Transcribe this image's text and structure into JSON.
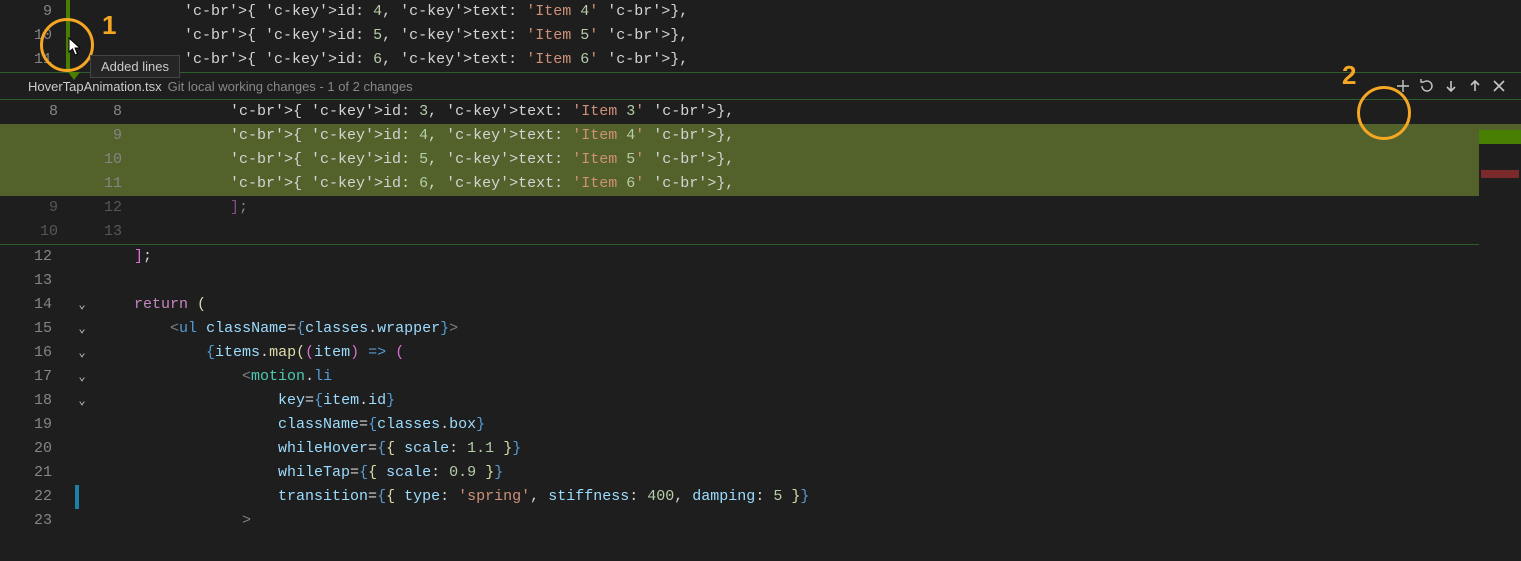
{
  "tooltip": "Added lines",
  "callouts": {
    "one": "1",
    "two": "2"
  },
  "top_editor": {
    "lines": [
      {
        "n": "9",
        "code": "{ id: 4, text: 'Item 4' },"
      },
      {
        "n": "10",
        "code": "{ id: 5, text: 'Item 5' },"
      },
      {
        "n": "11",
        "code": "{ id: 6, text: 'Item 6' },"
      }
    ]
  },
  "diff_header": {
    "filename": "HoverTapAnimation.tsx",
    "meta": "Git local working changes - 1 of 2 changes"
  },
  "diff_view": {
    "rows": [
      {
        "old": "8",
        "new": "8",
        "added": false,
        "code": "{ id: 3, text: 'Item 3' },"
      },
      {
        "old": "",
        "new": "9",
        "added": true,
        "code": "{ id: 4, text: 'Item 4' },"
      },
      {
        "old": "",
        "new": "10",
        "added": true,
        "code": "{ id: 5, text: 'Item 5' },"
      },
      {
        "old": "",
        "new": "11",
        "added": true,
        "code": "{ id: 6, text: 'Item 6' },"
      },
      {
        "old": "9",
        "new": "12",
        "added": false,
        "code": "];"
      },
      {
        "old": "10",
        "new": "13",
        "added": false,
        "code": ""
      }
    ]
  },
  "bottom_editor": {
    "lines": [
      {
        "n": "12",
        "fold": "",
        "code_html": "b12"
      },
      {
        "n": "13",
        "fold": "",
        "code_html": "blank"
      },
      {
        "n": "14",
        "fold": "v",
        "code_html": "b14"
      },
      {
        "n": "15",
        "fold": "v",
        "code_html": "b15"
      },
      {
        "n": "16",
        "fold": "v",
        "code_html": "b16"
      },
      {
        "n": "17",
        "fold": "v",
        "code_html": "b17"
      },
      {
        "n": "18",
        "fold": "v",
        "code_html": "b18"
      },
      {
        "n": "19",
        "fold": "",
        "code_html": "b19"
      },
      {
        "n": "20",
        "fold": "",
        "code_html": "b20"
      },
      {
        "n": "21",
        "fold": "",
        "code_html": "b21"
      },
      {
        "n": "22",
        "fold": "",
        "code_html": "b22"
      },
      {
        "n": "23",
        "fold": "",
        "code_html": "b23"
      }
    ],
    "snippets": {
      "b12": "<span class='c-br2'>]</span><span class='c-pun'>;</span>",
      "blank": "",
      "b14": "<span class='c-kw'>return</span> <span class='c-br'>(</span>",
      "b15": "    <span class='c-lt'>&lt;</span><span class='c-tag'>ul</span> <span class='c-key'>className</span><span class='c-pun'>=</span><span class='c-br3'>{</span><span class='c-key'>classes</span><span class='c-pun'>.</span><span class='c-key'>wrapper</span><span class='c-br3'>}</span><span class='c-lt'>&gt;</span>",
      "b16": "        <span class='c-br3'>{</span><span class='c-key'>items</span><span class='c-pun'>.</span><span class='c-fn'>map</span><span class='c-br'>(</span><span class='c-br2'>(</span><span class='c-key'>item</span><span class='c-br2'>)</span> <span class='c-tag'>=&gt;</span> <span class='c-br2'>(</span>",
      "b17": "            <span class='c-lt'>&lt;</span><span class='c-comp'>motion</span><span class='c-pun'>.</span><span class='c-tag'>li</span>",
      "b18": "                <span class='c-key'>key</span><span class='c-pun'>=</span><span class='c-br3'>{</span><span class='c-key'>item</span><span class='c-pun'>.</span><span class='c-key'>id</span><span class='c-br3'>}</span>",
      "b19": "                <span class='c-key'>className</span><span class='c-pun'>=</span><span class='c-br3'>{</span><span class='c-key'>classes</span><span class='c-pun'>.</span><span class='c-key'>box</span><span class='c-br3'>}</span>",
      "b20": "                <span class='c-key'>whileHover</span><span class='c-pun'>=</span><span class='c-br3'>{</span><span class='c-br'>{</span> <span class='c-key'>scale</span><span class='c-pun'>:</span> <span class='c-num'>1.1</span> <span class='c-br'>}</span><span class='c-br3'>}</span>",
      "b21": "                <span class='c-key'>whileTap</span><span class='c-pun'>=</span><span class='c-br3'>{</span><span class='c-br'>{</span> <span class='c-key'>scale</span><span class='c-pun'>:</span> <span class='c-num'>0.9</span> <span class='c-br'>}</span><span class='c-br3'>}</span>",
      "b22": "                <span class='c-key'>transition</span><span class='c-pun'>=</span><span class='c-br3'>{</span><span class='c-br'>{</span> <span class='c-key'>type</span><span class='c-pun'>:</span> <span class='c-str'>'spring'</span><span class='c-pun'>,</span> <span class='c-key'>stiffness</span><span class='c-pun'>:</span> <span class='c-num'>400</span><span class='c-pun'>,</span> <span class='c-key'>damping</span><span class='c-pun'>:</span> <span class='c-num'>5</span> <span class='c-br'>}</span><span class='c-br3'>}</span>",
      "b23": "            <span class='c-lt'>&gt;</span>"
    }
  }
}
